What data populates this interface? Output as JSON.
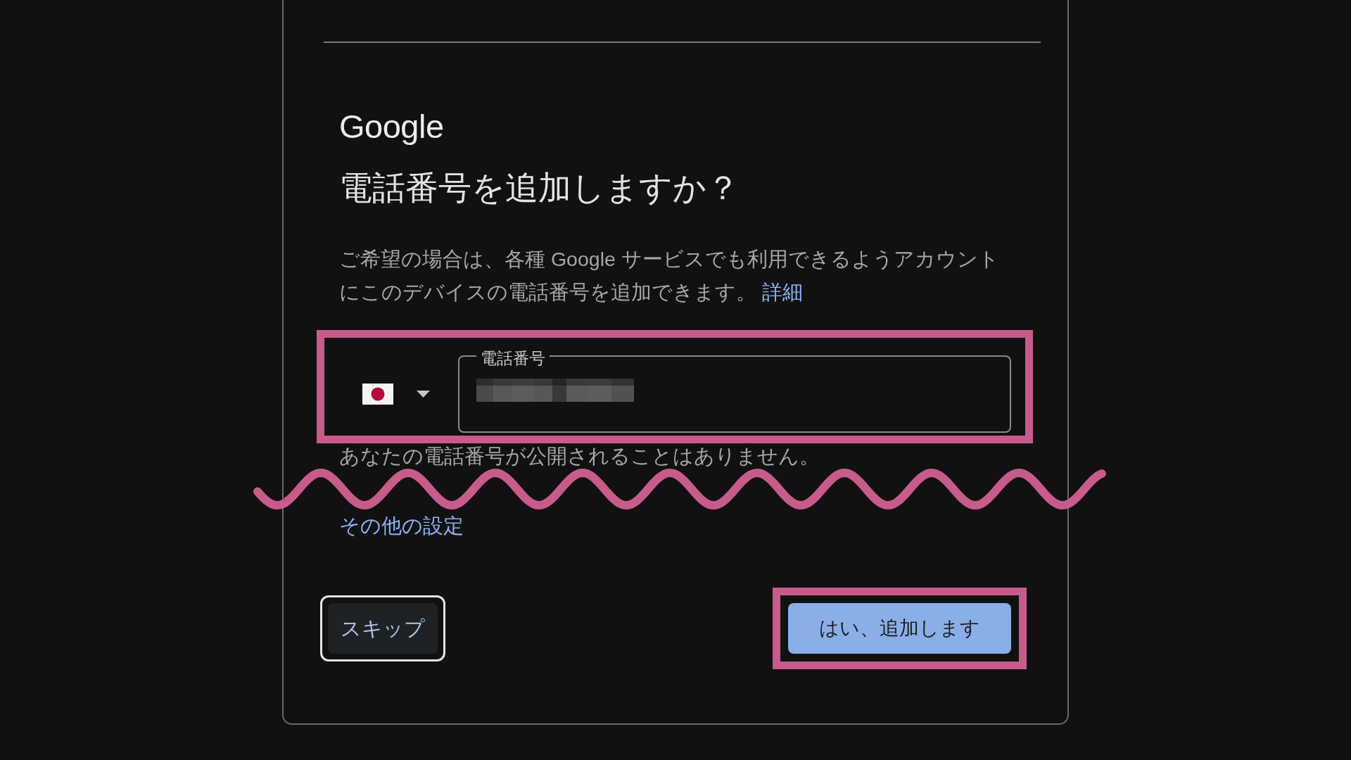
{
  "card": {
    "logo": "Google",
    "title": "電話番号を追加しますか？",
    "description": {
      "text": "ご希望の場合は、各種 Google サービスでも利用できるようアカウントにこのデバイスの電話番号を追加できます。",
      "link": "詳細"
    },
    "phone_entry": {
      "highlighted": true,
      "field": {
        "label": "電話番号",
        "value_redacted": true
      }
    },
    "hint": "あなたの電話番号が公開されることはありません。",
    "omission_mark": true,
    "more_settings_link": "その他の設定",
    "buttons": [
      {
        "label": "スキップ",
        "kind": "text",
        "focused": true,
        "highlighted": false
      },
      {
        "label": "はい、追加します",
        "kind": "filled",
        "focused": false,
        "highlighted": true
      }
    ]
  }
}
